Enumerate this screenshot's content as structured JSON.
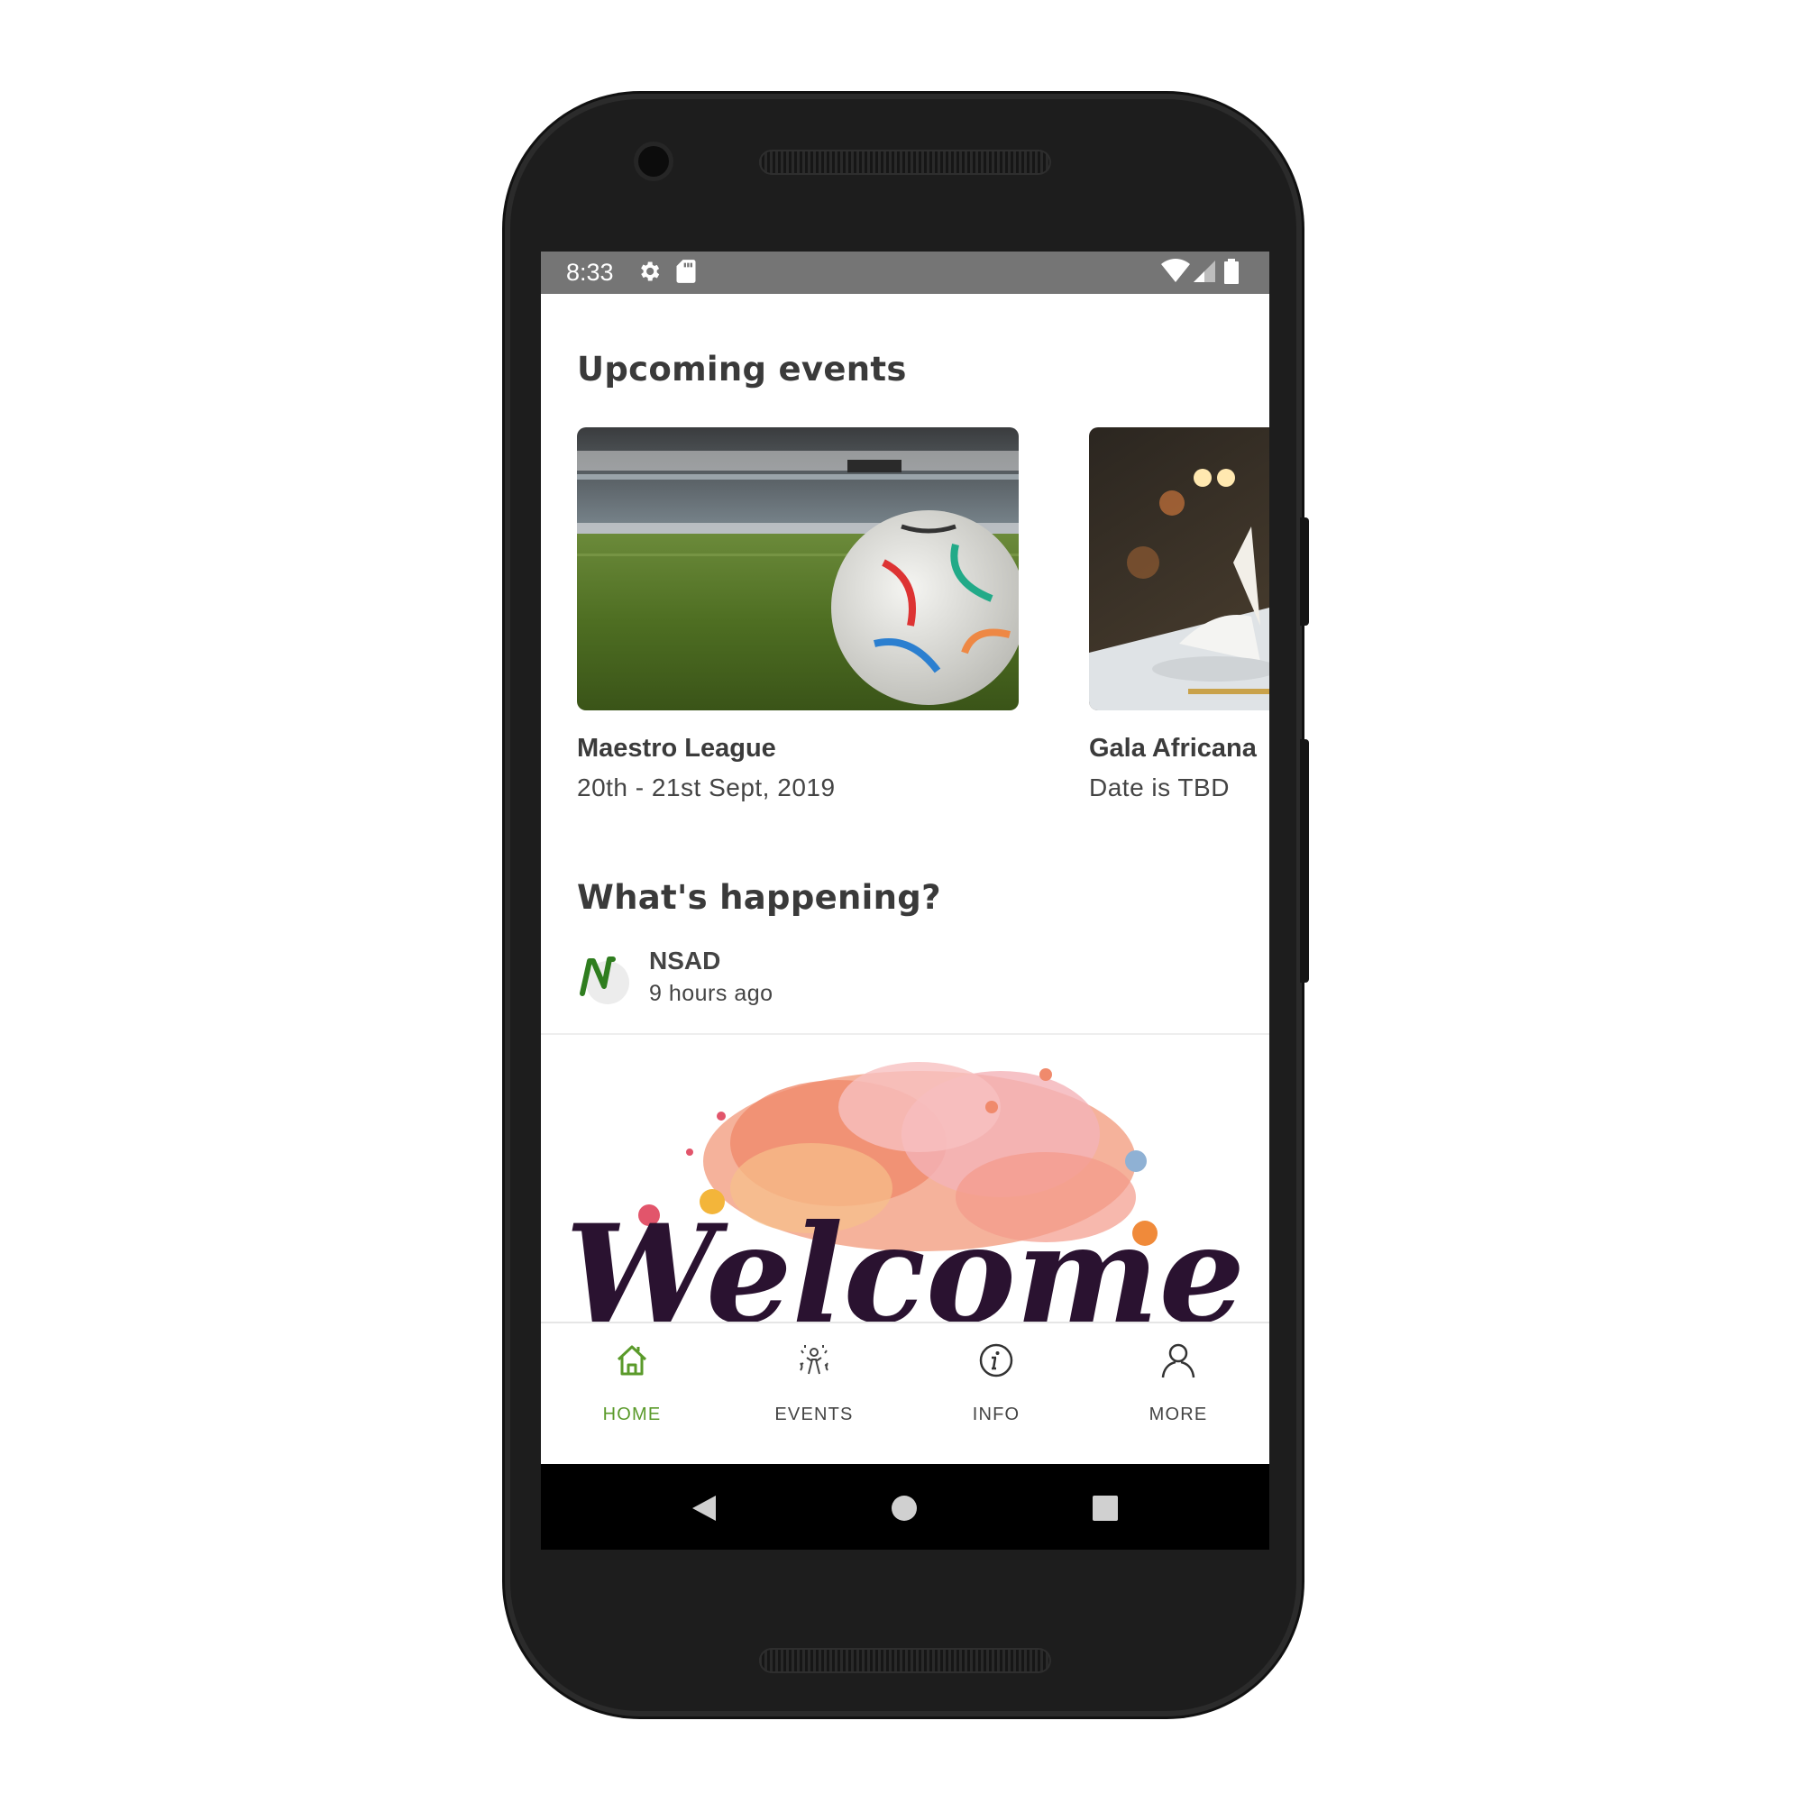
{
  "status_bar": {
    "time": "8:33",
    "left_icons": [
      "settings-icon",
      "sd-card-icon"
    ],
    "right_icons": [
      "wifi-icon",
      "cell-signal-icon",
      "battery-icon"
    ],
    "background": "#757575"
  },
  "upcoming": {
    "title": "Upcoming events",
    "events": [
      {
        "name": "Maestro League",
        "date": "20th - 21st Sept, 2019"
      },
      {
        "name": "Gala Africana",
        "date": "Date is TBD"
      }
    ]
  },
  "happening": {
    "title": "What's happening?",
    "post": {
      "author": "NSAD",
      "time": "9 hours ago",
      "image_text": "Welcome"
    }
  },
  "bottom_nav": {
    "active_color": "#5a9a2a",
    "items": [
      {
        "label": "HOME",
        "icon": "home-icon",
        "active": true
      },
      {
        "label": "EVENTS",
        "icon": "celebration-icon",
        "active": false
      },
      {
        "label": "INFO",
        "icon": "info-icon",
        "active": false
      },
      {
        "label": "MORE",
        "icon": "person-icon",
        "active": false
      }
    ]
  },
  "system_nav": {
    "buttons": [
      "back-icon",
      "home-circle-icon",
      "recents-icon"
    ]
  }
}
